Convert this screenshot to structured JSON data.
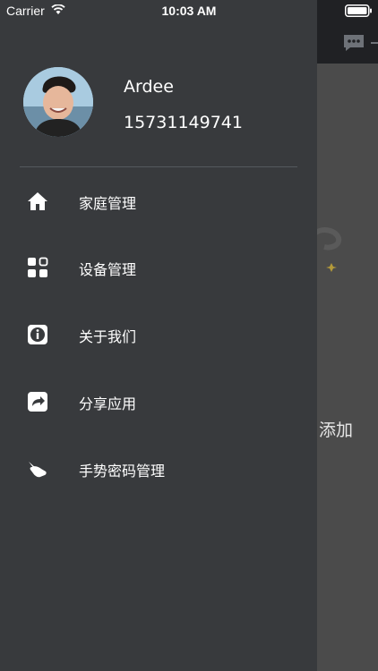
{
  "status_bar": {
    "carrier": "Carrier",
    "time": "10:03 AM"
  },
  "background_screen": {
    "add_label": "添加",
    "icons": [
      "chat-bubble-icon",
      "arrow-right-icon",
      "placeholder-illustration"
    ]
  },
  "drawer": {
    "user": {
      "name": "Ardee",
      "phone": "15731149741"
    },
    "menu": [
      {
        "label": "家庭管理",
        "icon": "home-icon"
      },
      {
        "label": "设备管理",
        "icon": "grid-icon"
      },
      {
        "label": "关于我们",
        "icon": "info-icon"
      },
      {
        "label": "分享应用",
        "icon": "share-icon"
      },
      {
        "label": "手势密码管理",
        "icon": "gesture-icon"
      }
    ]
  },
  "colors": {
    "drawer_bg": "#383a3d",
    "topbar_bg": "#202124",
    "main_bg": "#4b4b4b",
    "text": "#ffffff"
  }
}
